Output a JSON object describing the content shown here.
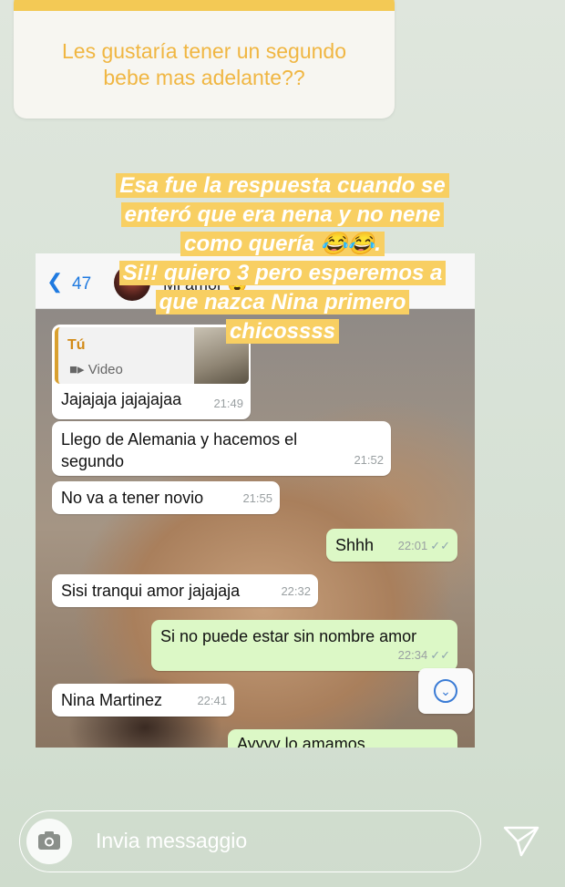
{
  "question_card": {
    "text_line1": "Les gustaría tener un segundo",
    "text_line2": "bebe mas adelante??"
  },
  "caption": {
    "lines": [
      "Esa fue la respuesta cuando se",
      "enteró que era nena y no nene",
      "como quería 😂😂.",
      "Si!! quiero 3 pero esperemos a",
      "que nazca Nina primero",
      "chicossss"
    ]
  },
  "chat": {
    "header": {
      "back_count": "47",
      "contact_name": "Mi amor 😍"
    },
    "quote": {
      "sender": "Tú",
      "type_label": "Video"
    },
    "messages": [
      {
        "text": "Jajajaja jajajajaa",
        "time": "21:49",
        "dir": "in"
      },
      {
        "text": "Llego de Alemania y hacemos el segundo",
        "time": "21:52",
        "dir": "in"
      },
      {
        "text": "No va a tener novio",
        "time": "21:55",
        "dir": "in"
      },
      {
        "text": "Shhh",
        "time": "22:01",
        "dir": "out"
      },
      {
        "text": "Sisi tranqui amor jajajaja",
        "time": "22:32",
        "dir": "in"
      },
      {
        "text": "Si no puede estar sin nombre amor",
        "time": "22:34",
        "dir": "out"
      },
      {
        "text": "Nina Martinez",
        "time": "22:41",
        "dir": "in"
      },
      {
        "text": "Ayyyy lo amamos",
        "time": "",
        "dir": "out"
      }
    ]
  },
  "reply_bar": {
    "placeholder": "Invia messaggio"
  },
  "colors": {
    "caption_bg": "#f8cf62",
    "question_text": "#f0b642",
    "out_bubble": "#dcf8c6",
    "link_blue": "#1f7ae0"
  },
  "icons": {
    "camera": "camera-icon",
    "send": "send-icon",
    "back": "chevron-left-icon",
    "scroll_down": "chevron-down-circle-icon",
    "video": "video-icon"
  }
}
